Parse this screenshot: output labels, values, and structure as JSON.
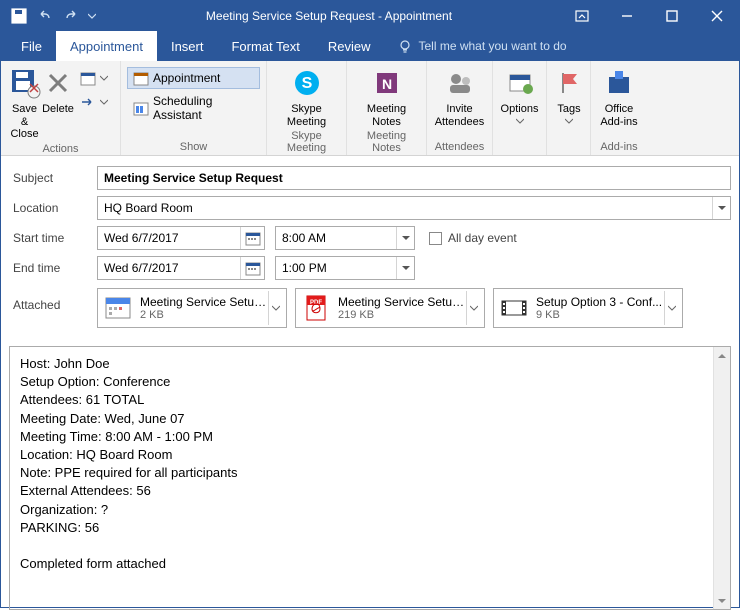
{
  "window": {
    "title": "Meeting Service Setup Request  -  Appointment"
  },
  "tabs": {
    "file": "File",
    "appointment": "Appointment",
    "insert": "Insert",
    "format_text": "Format Text",
    "review": "Review",
    "tellme": "Tell me what you want to do"
  },
  "ribbon": {
    "actions": {
      "save_close": "Save & Close",
      "delete": "Delete",
      "label": "Actions"
    },
    "show": {
      "appointment": "Appointment",
      "scheduling": "Scheduling Assistant",
      "label": "Show"
    },
    "skype": {
      "btn": "Skype Meeting",
      "label": "Skype Meeting"
    },
    "notes": {
      "btn": "Meeting Notes",
      "label": "Meeting Notes"
    },
    "attendees": {
      "btn": "Invite Attendees",
      "label": "Attendees"
    },
    "options": {
      "btn": "Options"
    },
    "tags": {
      "btn": "Tags"
    },
    "addins": {
      "btn": "Office Add-ins",
      "label": "Add-ins"
    }
  },
  "form": {
    "subject_label": "Subject",
    "subject": "Meeting Service Setup Request",
    "location_label": "Location",
    "location": "HQ Board Room",
    "start_label": "Start time",
    "start_date": "Wed 6/7/2017",
    "start_time": "8:00 AM",
    "allday_label": "All day event",
    "end_label": "End time",
    "end_date": "Wed 6/7/2017",
    "end_time": "1:00 PM",
    "attached_label": "Attached"
  },
  "attachments": [
    {
      "name": "Meeting Service Setup...",
      "size": "2 KB",
      "type": "cal"
    },
    {
      "name": "Meeting Service Setup...",
      "size": "219 KB",
      "type": "pdf"
    },
    {
      "name": "Setup Option 3 - Conf...",
      "size": "9 KB",
      "type": "img"
    }
  ],
  "body": {
    "l1": "Host: John Doe",
    "l2": "Setup Option: Conference",
    "l3": "Attendees: 61 TOTAL",
    "l4": "Meeting Date: Wed, June 07",
    "l5": "Meeting Time: 8:00 AM - 1:00 PM",
    "l6": "Location: HQ Board Room",
    "l7": "Note: PPE required for all participants",
    "l8": "External Attendees: 56",
    "l9": "Organization: ?",
    "l10": "PARKING: 56",
    "l11": "Completed form attached"
  }
}
